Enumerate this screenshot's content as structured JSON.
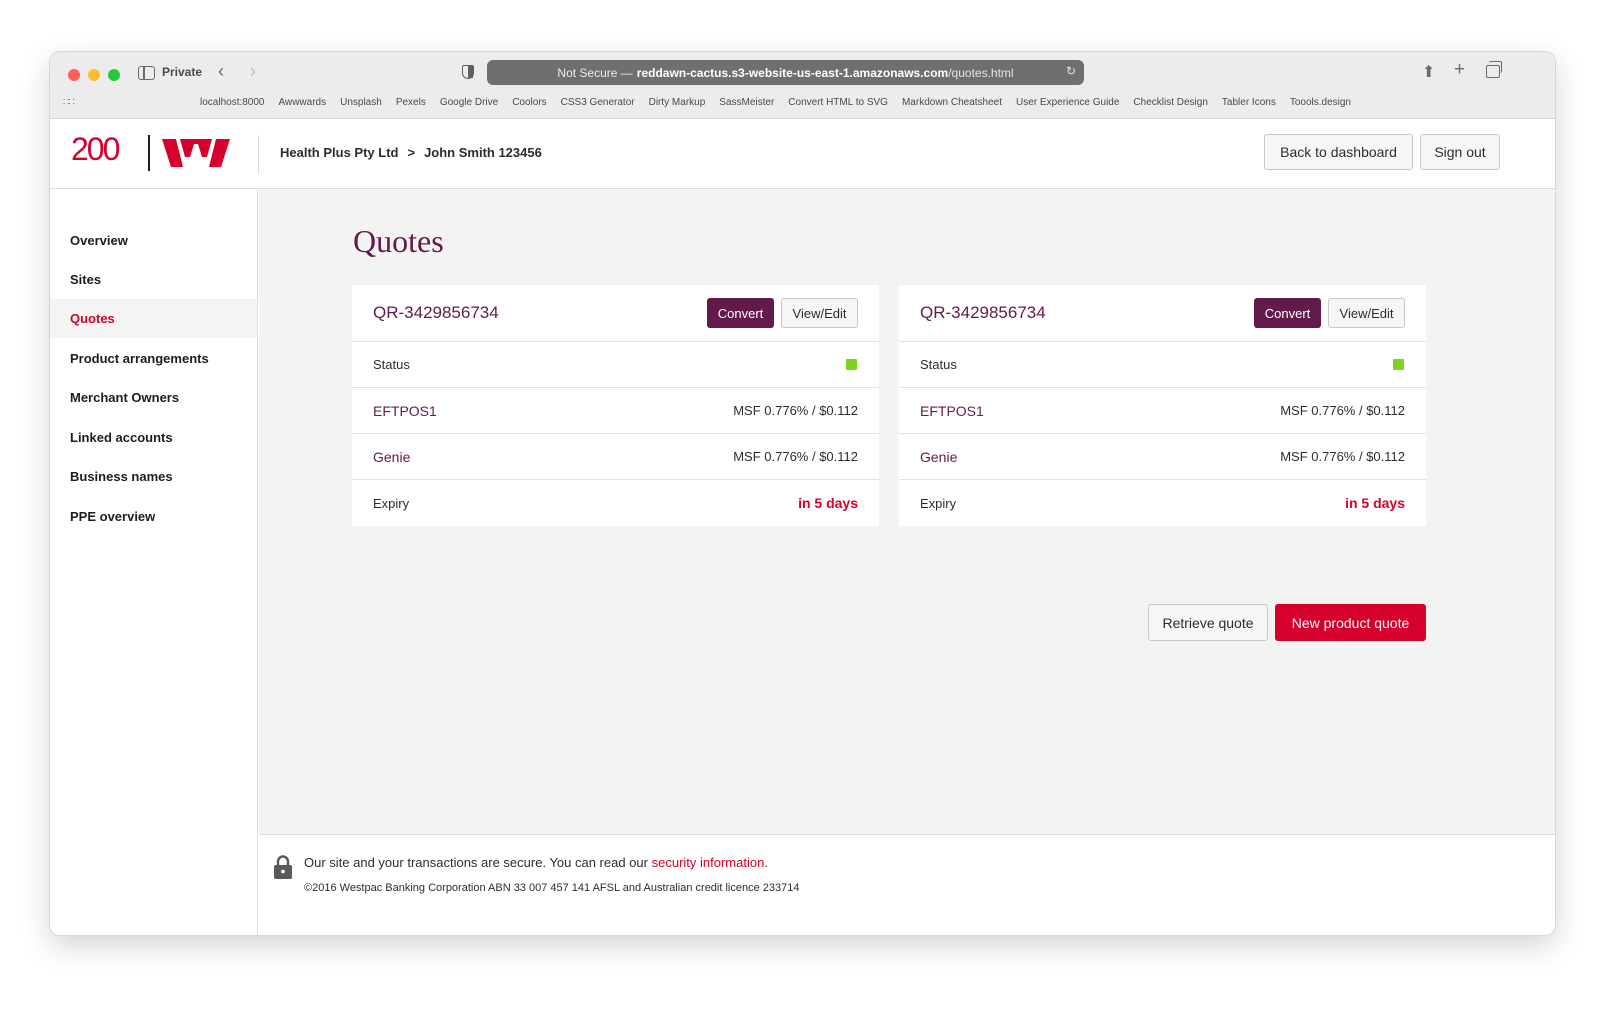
{
  "browser": {
    "private_label": "Private",
    "url_prefix": "Not Secure —",
    "url_host": "reddawn-cactus.s3-website-us-east-1.amazonaws.com",
    "url_path": "/quotes.html",
    "bookmarks": [
      "localhost:8000",
      "Awwwards",
      "Unsplash",
      "Pexels",
      "Google Drive",
      "Coolors",
      "CSS3 Generator",
      "Dirty Markup",
      "SassMeister",
      "Convert HTML to SVG",
      "Markdown Cheatsheet",
      "User Experience Guide",
      "Checklist Design",
      "Tabler Icons",
      "Toools.design"
    ]
  },
  "header": {
    "logo_text": "200",
    "breadcrumb": {
      "company": "Health Plus Pty Ltd",
      "separator": ">",
      "customer": "John Smith 123456"
    },
    "back_label": "Back to dashboard",
    "signout_label": "Sign out"
  },
  "sidebar": {
    "items": [
      {
        "label": "Overview",
        "active": false
      },
      {
        "label": "Sites",
        "active": false
      },
      {
        "label": "Quotes",
        "active": true
      },
      {
        "label": "Product arrangements",
        "active": false
      },
      {
        "label": "Merchant Owners",
        "active": false
      },
      {
        "label": "Linked accounts",
        "active": false
      },
      {
        "label": "Business names",
        "active": false
      },
      {
        "label": "PPE overview",
        "active": false
      }
    ]
  },
  "main": {
    "title": "Quotes",
    "quotes": [
      {
        "id": "QR-3429856734",
        "convert_label": "Convert",
        "view_label": "View/Edit",
        "status_label": "Status",
        "status_color": "#7ed321",
        "products": [
          {
            "name": "EFTPOS1",
            "value": "MSF 0.776% / $0.112"
          },
          {
            "name": "Genie",
            "value": "MSF 0.776% / $0.112"
          }
        ],
        "expiry_label": "Expiry",
        "expiry_value": "in 5 days"
      },
      {
        "id": "QR-3429856734",
        "convert_label": "Convert",
        "view_label": "View/Edit",
        "status_label": "Status",
        "status_color": "#7ed321",
        "products": [
          {
            "name": "EFTPOS1",
            "value": "MSF 0.776% / $0.112"
          },
          {
            "name": "Genie",
            "value": "MSF 0.776% / $0.112"
          }
        ],
        "expiry_label": "Expiry",
        "expiry_value": "in 5 days"
      }
    ],
    "retrieve_label": "Retrieve quote",
    "new_quote_label": "New product quote"
  },
  "footer": {
    "secure_text": "Our site and your transactions are secure. You can read our",
    "link_text": "security information",
    "period": ".",
    "copyright": "©2016 Westpac Banking Corporation ABN 33 007 457 141 AFSL and Australian credit licence 233714"
  },
  "colors": {
    "brand_red": "#d5002b",
    "brand_plum": "#621a4b",
    "status_green": "#7ed321"
  },
  "icons": [
    "shield-icon",
    "share-icon",
    "plus-icon",
    "tabs-icon",
    "grid-icon",
    "sidebar-toggle-icon",
    "back-arrow-icon",
    "forward-arrow-icon",
    "reload-icon",
    "westpac-logo-icon",
    "lock-icon"
  ]
}
